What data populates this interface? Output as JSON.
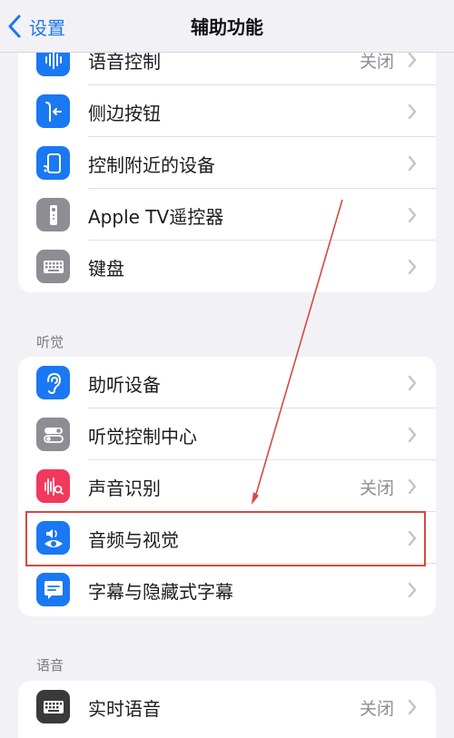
{
  "nav": {
    "back_label": "设置",
    "title": "辅助功能"
  },
  "groups": [
    {
      "rows": [
        {
          "label": "语音控制",
          "value": "关闭",
          "icon": "voice-control-icon",
          "color": "#1a78f2"
        },
        {
          "label": "侧边按钮",
          "value": "",
          "icon": "side-button-icon",
          "color": "#1a78f2"
        },
        {
          "label": "控制附近的设备",
          "value": "",
          "icon": "nearby-devices-icon",
          "color": "#1a78f2"
        },
        {
          "label": "Apple TV遥控器",
          "value": "",
          "icon": "apple-tv-remote-icon",
          "color": "#8e8d93"
        },
        {
          "label": "键盘",
          "value": "",
          "icon": "keyboard-icon",
          "color": "#8e8d93"
        }
      ]
    },
    {
      "header": "听觉",
      "rows": [
        {
          "label": "助听设备",
          "value": "",
          "icon": "ear-icon",
          "color": "#1a78f2"
        },
        {
          "label": "听觉控制中心",
          "value": "",
          "icon": "toggles-icon",
          "color": "#8e8d93"
        },
        {
          "label": "声音识别",
          "value": "关闭",
          "icon": "sound-recognition-icon",
          "color": "#f0395c"
        },
        {
          "label": "音频与视觉",
          "value": "",
          "icon": "audio-visual-icon",
          "color": "#1a78f2"
        },
        {
          "label": "字幕与隐藏式字幕",
          "value": "",
          "icon": "subtitles-icon",
          "color": "#1a78f2"
        }
      ]
    },
    {
      "header": "语音",
      "rows": [
        {
          "label": "实时语音",
          "value": "关闭",
          "icon": "live-speech-icon",
          "color": "#3a3a3c"
        }
      ]
    }
  ],
  "annotation": {
    "highlight_color": "#d6493f"
  }
}
